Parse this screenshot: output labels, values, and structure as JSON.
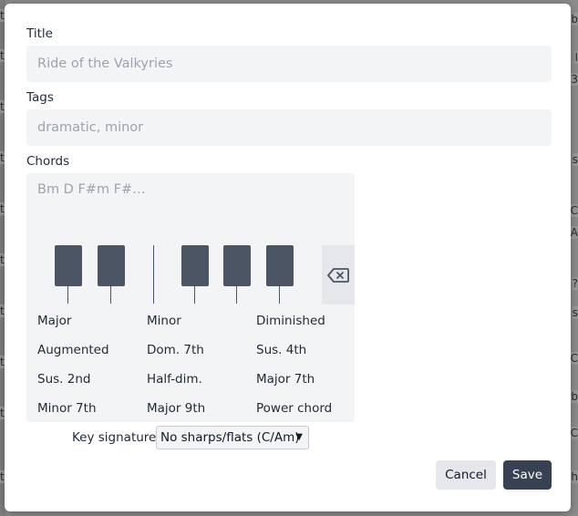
{
  "background": {
    "right_marks": [
      "b",
      "I",
      "3",
      "s",
      "C",
      "A",
      "?",
      "s",
      "C",
      "b",
      "C",
      "h"
    ],
    "left_marks": [
      "t",
      "t",
      "t",
      "t",
      "t",
      "t",
      "t",
      "t",
      "t",
      "t"
    ]
  },
  "dialog": {
    "title_label": "Title",
    "title_placeholder": "Ride of the Valkyries",
    "tags_label": "Tags",
    "tags_placeholder": "dramatic, minor",
    "chords_label": "Chords",
    "chords_placeholder": "Bm D F#m F#…",
    "backspace_icon": "backspace-icon",
    "chord_types": [
      "Major",
      "Minor",
      "Diminished",
      "Augmented",
      "Dom. 7th",
      "Sus. 4th",
      "Sus. 2nd",
      "Half-dim.",
      "Major 7th",
      "Minor 7th",
      "Major 9th",
      "Power chord"
    ],
    "key_signature_label": "Key signature",
    "key_signature_value": "No sharps/flats (C/Am)",
    "cancel_label": "Cancel",
    "save_label": "Save"
  },
  "colors": {
    "accent_dark": "#374151",
    "key_dark": "#4b5563",
    "field_bg": "#f3f4f6"
  }
}
